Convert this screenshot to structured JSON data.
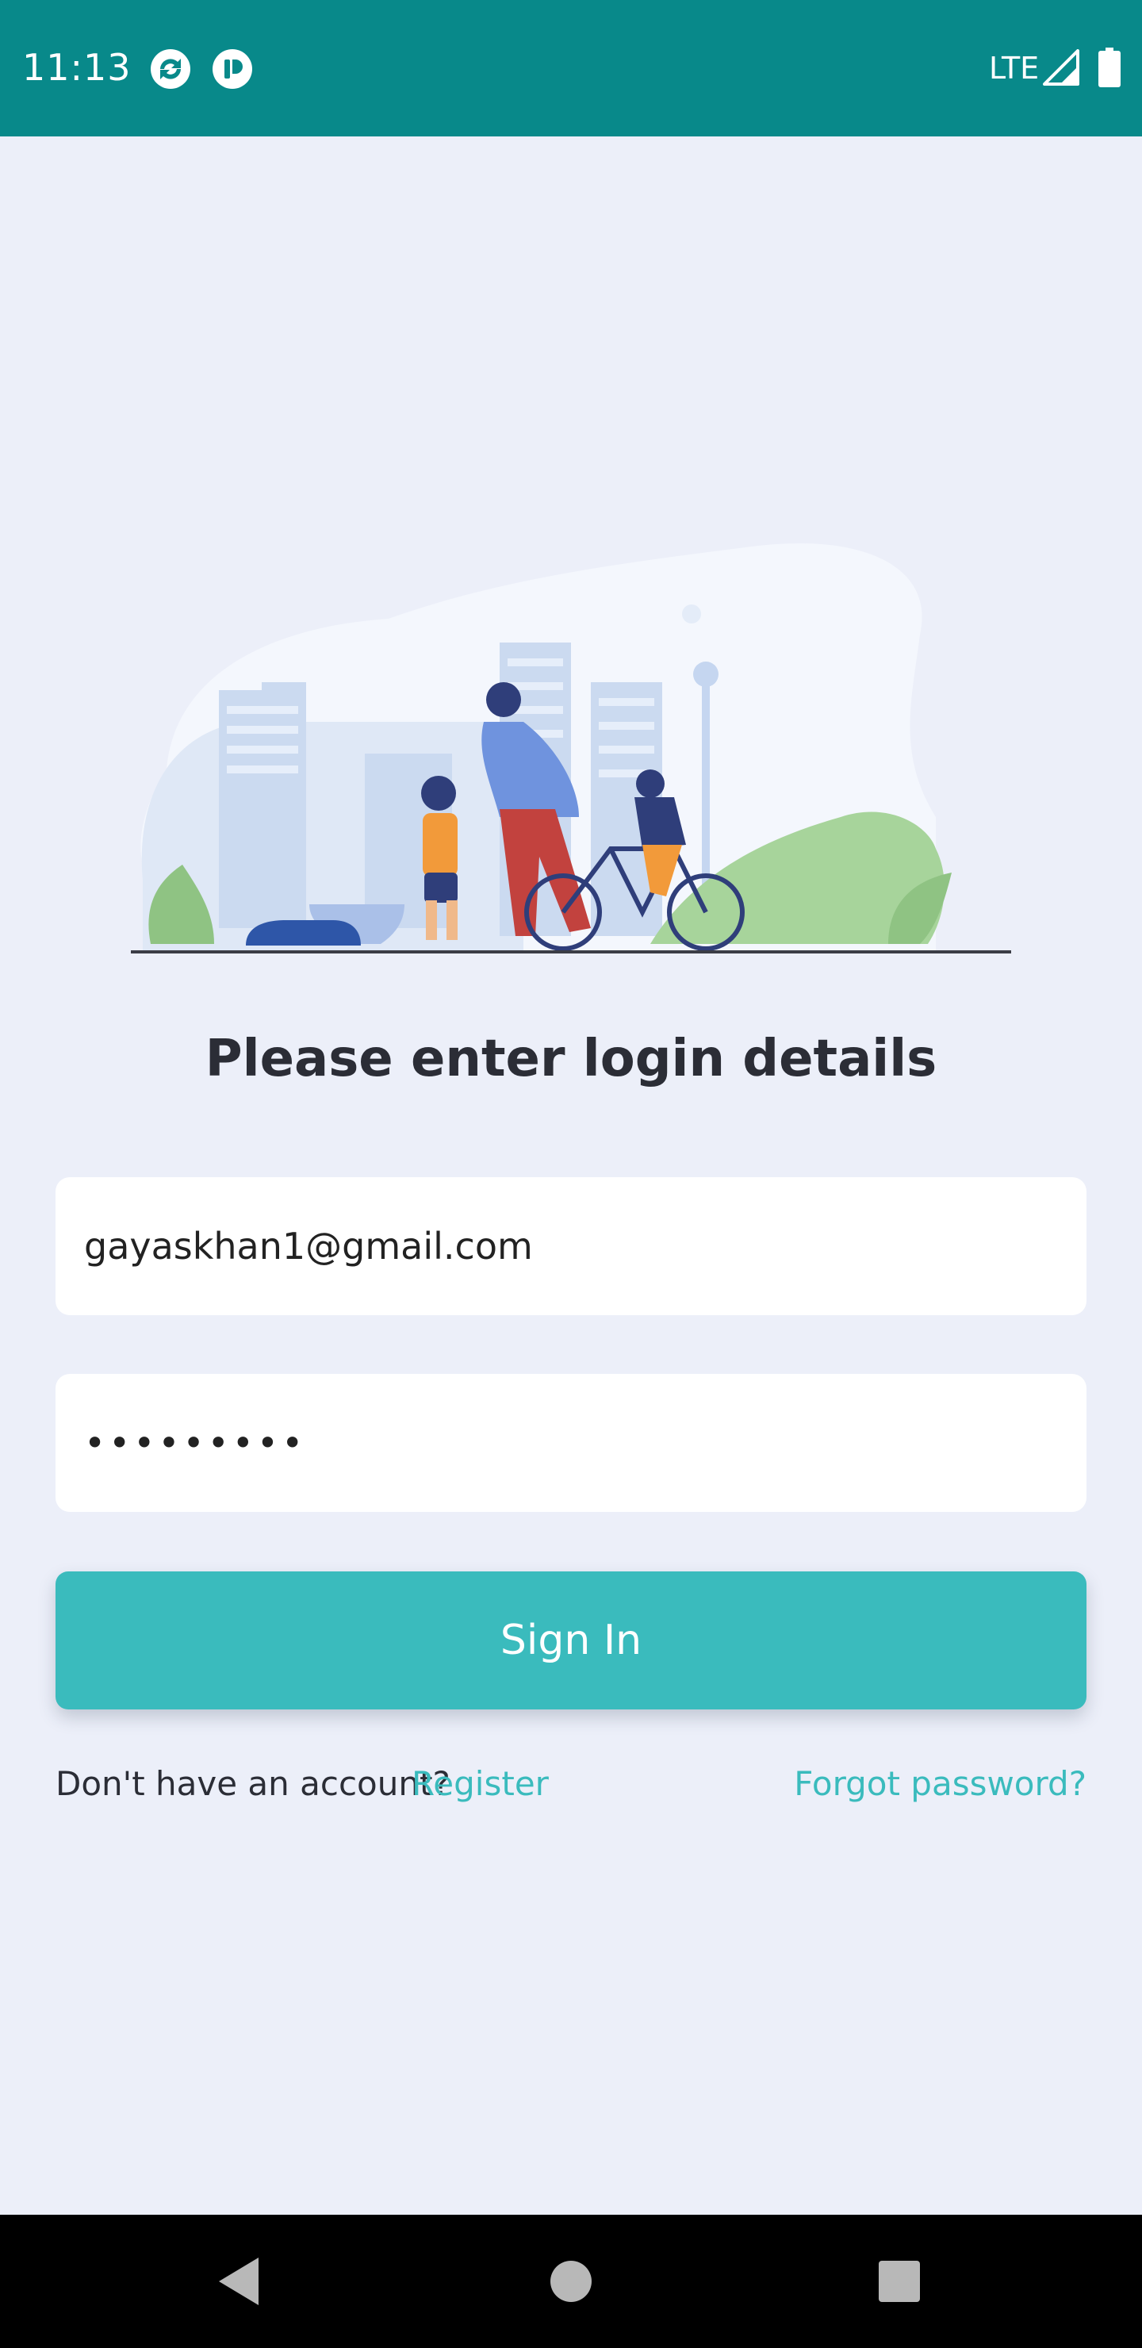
{
  "status_bar": {
    "time": "11:13",
    "network": "LTE",
    "background_color": "#08898a",
    "icons": [
      "sync-app-icon",
      "notification-app-icon",
      "signal-icon",
      "battery-icon"
    ]
  },
  "login": {
    "heading": "Please enter login details",
    "email_value": "gayaskhan1@gmail.com",
    "password_value": "•••••••••",
    "signin_label": "Sign In",
    "no_account_text": "Don't have an account?",
    "register_label": "Register",
    "forgot_label": "Forgot password?",
    "accent_color": "#3abbbd"
  },
  "nav_bar": {
    "buttons": [
      "back-icon",
      "home-icon",
      "recents-icon"
    ]
  }
}
